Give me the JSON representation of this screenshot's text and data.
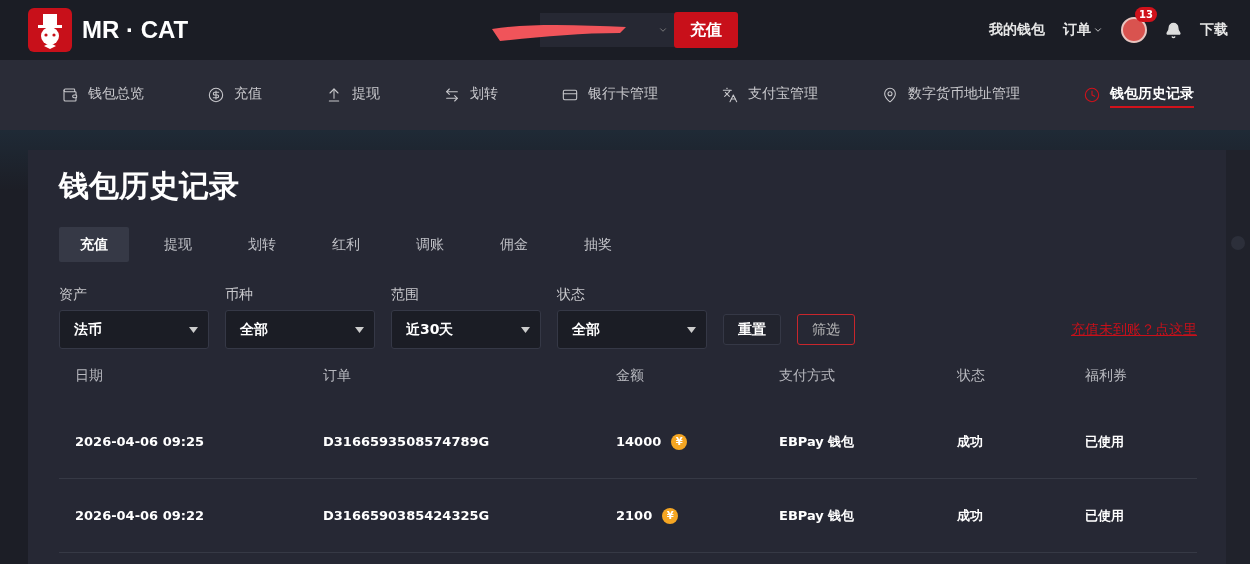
{
  "header": {
    "brand": "MR · CAT",
    "recharge_button": "充值",
    "links": [
      {
        "label": "我的钱包",
        "dropdown": false
      },
      {
        "label": "订单",
        "dropdown": true
      }
    ],
    "notification_count": "13",
    "download": "下载"
  },
  "nav": [
    {
      "label": "钱包总览",
      "kind": "wallet",
      "selected": false
    },
    {
      "label": "充值",
      "kind": "recharge",
      "selected": false
    },
    {
      "label": "提现",
      "kind": "withdraw",
      "selected": false
    },
    {
      "label": "划转",
      "kind": "transfer",
      "selected": false
    },
    {
      "label": "银行卡管理",
      "kind": "card",
      "selected": false
    },
    {
      "label": "支付宝管理",
      "kind": "alipay",
      "selected": false
    },
    {
      "label": "数字货币地址管理",
      "kind": "address",
      "selected": false
    },
    {
      "label": "钱包历史记录",
      "kind": "history",
      "selected": true
    }
  ],
  "page_title": "钱包历史记录",
  "tabs": [
    {
      "label": "充值",
      "selected": true
    },
    {
      "label": "提现",
      "selected": false
    },
    {
      "label": "划转",
      "selected": false
    },
    {
      "label": "红利",
      "selected": false
    },
    {
      "label": "调账",
      "selected": false
    },
    {
      "label": "佣金",
      "selected": false
    },
    {
      "label": "抽奖",
      "selected": false
    }
  ],
  "filters": [
    {
      "label": "资产",
      "value": "法币"
    },
    {
      "label": "币种",
      "value": "全部"
    },
    {
      "label": "范围",
      "value": "近30天"
    },
    {
      "label": "状态",
      "value": "全部"
    }
  ],
  "reset_button": "重置",
  "filter_button": "筛选",
  "help_link": "充值未到账？点这里",
  "table": {
    "columns": [
      "日期",
      "订单",
      "金额",
      "支付方式",
      "状态",
      "福利券"
    ],
    "rows": [
      {
        "date": "2026-04-06 09:25",
        "order": "D3166593508574789G",
        "amount": "14000",
        "coin": "¥",
        "method": "EBPay 钱包",
        "status": "成功",
        "coupon": "已使用"
      },
      {
        "date": "2026-04-06 09:22",
        "order": "D3166590385424325G",
        "amount": "2100",
        "coin": "¥",
        "method": "EBPay 钱包",
        "status": "成功",
        "coupon": "已使用"
      }
    ]
  }
}
